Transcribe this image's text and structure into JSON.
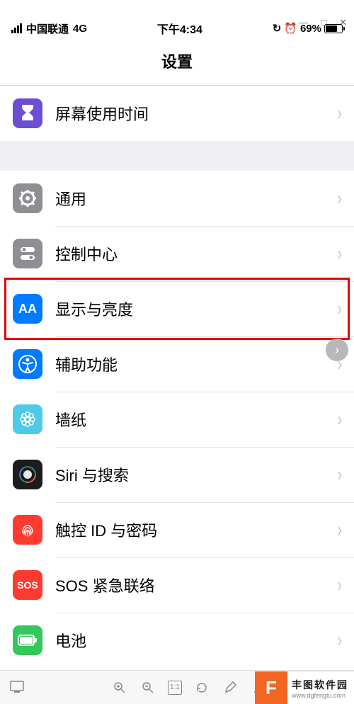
{
  "window": {
    "minimize": "—",
    "maximize": "□",
    "close": "✕"
  },
  "status": {
    "carrier": "中国联通",
    "network": "4G",
    "time": "下午4:34",
    "battery_pct": "69%"
  },
  "nav": {
    "title": "设置"
  },
  "rows": {
    "screentime": "屏幕使用时间",
    "general": "通用",
    "controlcenter": "控制中心",
    "display": "显示与亮度",
    "accessibility": "辅助功能",
    "wallpaper": "墙纸",
    "siri": "Siri 与搜索",
    "touchid": "触控 ID 与密码",
    "sos": "SOS 紧急联络",
    "battery": "电池"
  },
  "icons": {
    "sos_label": "SOS",
    "aa_label": "AA"
  },
  "toolbar": {
    "zoom_indicator": "1:1"
  },
  "watermark": {
    "badge": "F",
    "title": "丰图软件园",
    "url": "www.dgfengtu.com"
  }
}
